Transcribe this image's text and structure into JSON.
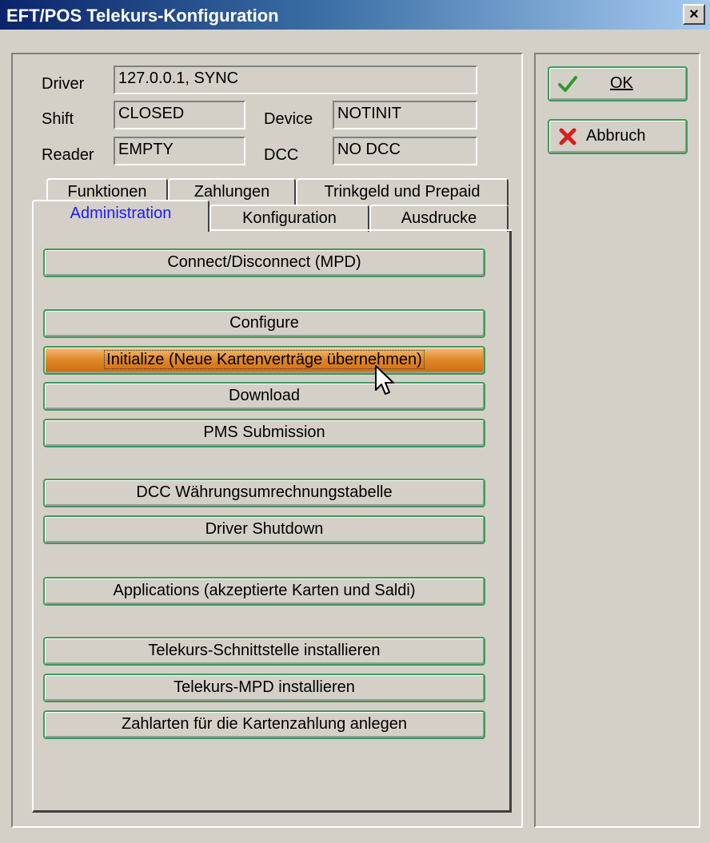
{
  "window": {
    "title": "EFT/POS Telekurs-Konfiguration",
    "close_symbol": "×"
  },
  "status": {
    "driver_label": "Driver",
    "driver_value": "127.0.0.1, SYNC",
    "shift_label": "Shift",
    "shift_value": "CLOSED",
    "device_label": "Device",
    "device_value": "NOTINIT",
    "reader_label": "Reader",
    "reader_value": "EMPTY",
    "dcc_label": "DCC",
    "dcc_value": "NO DCC"
  },
  "tabs": {
    "row1": [
      "Funktionen",
      "Zahlungen",
      "Trinkgeld und Prepaid"
    ],
    "row2": [
      "Administration",
      "Konfiguration",
      "Ausdrucke"
    ],
    "active": "Administration"
  },
  "actions": [
    "Connect/Disconnect (MPD)",
    "Configure",
    "Initialize (Neue Kartenverträge übernehmen)",
    "Download",
    "PMS Submission",
    "DCC Währungsumrechnungstabelle",
    "Driver Shutdown",
    "Applications (akzeptierte Karten und Saldi)",
    "Telekurs-Schnittstelle installieren",
    "Telekurs-MPD installieren",
    "Zahlarten für die Kartenzahlung anlegen"
  ],
  "buttons": {
    "ok_label": "OK",
    "cancel_label": "Abbruch"
  },
  "icons": {
    "ok": "checkmark-icon",
    "cancel": "red-x-icon"
  },
  "colors": {
    "titlebar_start": "#0a246a",
    "active_tab_text": "#1a1aff",
    "hover_button": "#e18a2a",
    "button_border": "#3d9a5a"
  }
}
